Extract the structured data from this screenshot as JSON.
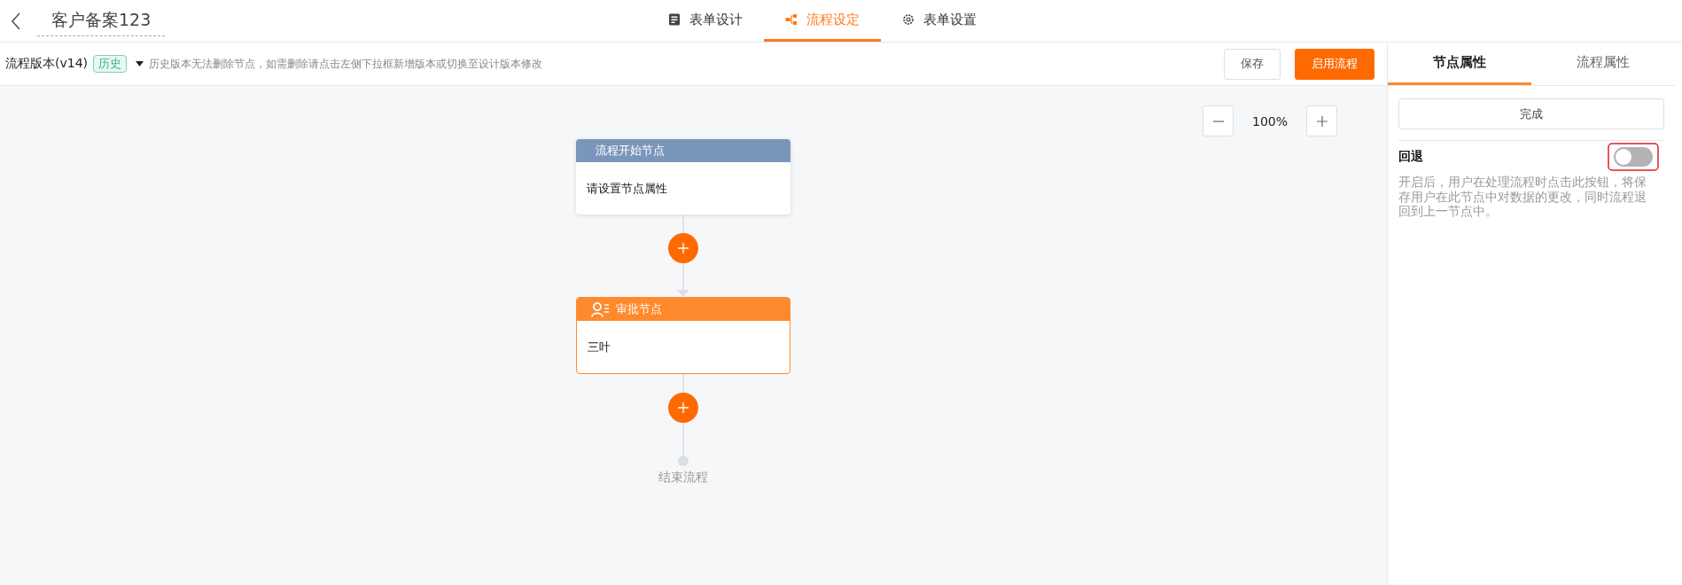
{
  "header": {
    "title": "客户备案123",
    "tabs": [
      {
        "kind": "form",
        "label": "表单设计",
        "selected": false
      },
      {
        "kind": "flow",
        "label": "流程设定",
        "selected": true
      },
      {
        "kind": "settings",
        "label": "表单设置",
        "selected": false
      }
    ]
  },
  "toolbar": {
    "version": "流程版本(v14)",
    "tag": "历史",
    "hint": "历史版本无法删除节点，如需删除请点击左侧下拉框新增版本或切换至设计版本修改",
    "buttons": [
      {
        "kind": "secondary",
        "label": "保存"
      },
      {
        "kind": "primary",
        "label": "启用流程"
      }
    ]
  },
  "canvas": {
    "zoom": "100%",
    "nodes": [
      {
        "kind": "start",
        "title": "流程开始节点",
        "body": "请设置节点属性"
      },
      {
        "kind": "approval",
        "title": "审批节点",
        "body": "三叶"
      }
    ],
    "end_label": "结束流程"
  },
  "panel": {
    "tabs": [
      {
        "label": "节点属性",
        "selected": true
      },
      {
        "label": "流程属性",
        "selected": false
      }
    ],
    "done_button": "完成",
    "setting": {
      "label": "回退",
      "on": false,
      "highlighted": true,
      "description": "开启后，用户在处理流程时点击此按钮，将保存用户在此节点中对数据的更改，同时流程退回到上一节点中。"
    }
  }
}
